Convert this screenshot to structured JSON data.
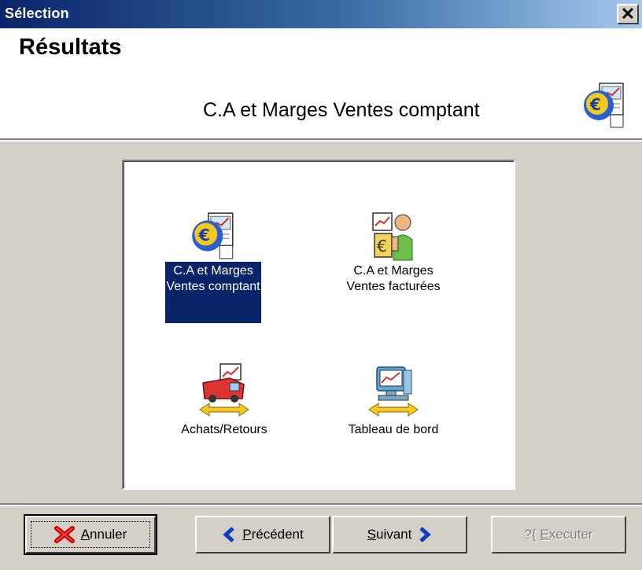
{
  "window": {
    "title": "Sélection"
  },
  "header": {
    "title": "Résultats",
    "subtitle": "C.A et Marges Ventes comptant"
  },
  "items": [
    {
      "line1": "C.A et Marges",
      "line2": "Ventes comptant",
      "icon": "euro-globe-chart-icon",
      "selected": true
    },
    {
      "line1": "C.A et Marges",
      "line2": "Ventes facturées",
      "icon": "person-euro-chart-icon",
      "selected": false
    },
    {
      "line1": "Achats/Retours",
      "line2": "",
      "icon": "truck-arrows-chart-icon",
      "selected": false
    },
    {
      "line1": "Tableau de bord",
      "line2": "",
      "icon": "computer-dashboard-icon",
      "selected": false
    }
  ],
  "buttons": {
    "cancel": {
      "first": "A",
      "rest": "nnuler"
    },
    "previous": {
      "first": "P",
      "rest": "récédent"
    },
    "next": {
      "first": "S",
      "rest": "uivant"
    },
    "execute": {
      "prefix": "?{ ",
      "first": "E",
      "rest": "xecuter"
    }
  },
  "colors": {
    "selection": "#0a246a",
    "dialog_bg": "#d4d0c8",
    "title_gradient_start": "#0a246a",
    "title_gradient_end": "#a6caf0"
  }
}
